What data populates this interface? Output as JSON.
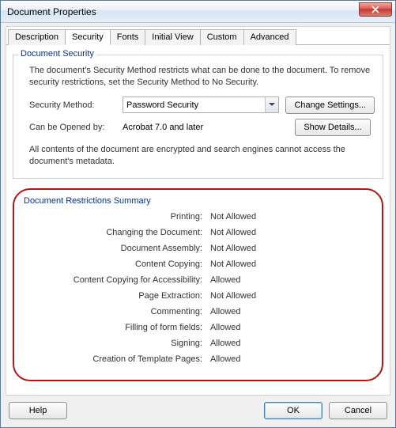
{
  "window": {
    "title": "Document Properties"
  },
  "tabs": {
    "description": "Description",
    "security": "Security",
    "fonts": "Fonts",
    "initial_view": "Initial View",
    "custom": "Custom",
    "advanced": "Advanced"
  },
  "security_group": {
    "title": "Document Security",
    "desc": "The document's Security Method restricts what can be done to the document. To remove security restrictions, set the Security Method to No Security.",
    "method_label": "Security Method:",
    "method_value": "Password Security",
    "change_settings": "Change Settings...",
    "opened_label": "Can be Opened by:",
    "opened_value": "Acrobat 7.0 and later",
    "show_details": "Show Details...",
    "note": "All contents of the document are encrypted and search engines cannot access the document's metadata."
  },
  "summary": {
    "title": "Document Restrictions Summary",
    "rows": [
      {
        "k": "Printing:",
        "v": "Not Allowed"
      },
      {
        "k": "Changing the Document:",
        "v": "Not Allowed"
      },
      {
        "k": "Document Assembly:",
        "v": "Not Allowed"
      },
      {
        "k": "Content Copying:",
        "v": "Not Allowed"
      },
      {
        "k": "Content Copying for Accessibility:",
        "v": "Allowed"
      },
      {
        "k": "Page Extraction:",
        "v": "Not Allowed"
      },
      {
        "k": "Commenting:",
        "v": "Allowed"
      },
      {
        "k": "Filling of form fields:",
        "v": "Allowed"
      },
      {
        "k": "Signing:",
        "v": "Allowed"
      },
      {
        "k": "Creation of Template Pages:",
        "v": "Allowed"
      }
    ]
  },
  "footer": {
    "help": "Help",
    "ok": "OK",
    "cancel": "Cancel"
  }
}
